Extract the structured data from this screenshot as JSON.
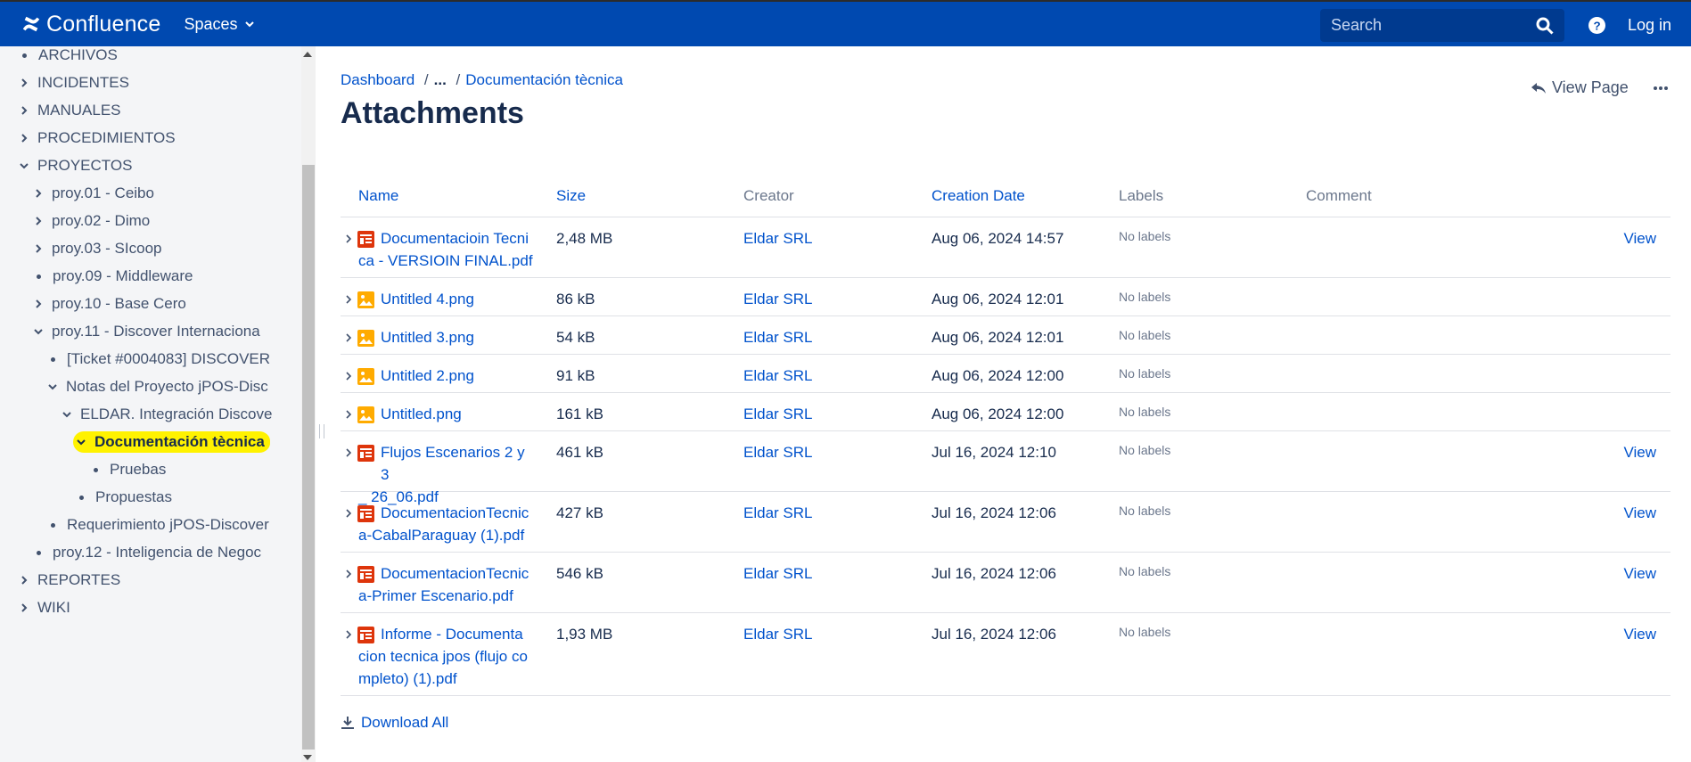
{
  "app": {
    "name": "Confluence",
    "spaces_label": "Spaces",
    "search_placeholder": "Search",
    "login_label": "Log in",
    "brand_color": "#0049b0"
  },
  "sidebar": {
    "items": [
      {
        "label": "ARCHIVOS",
        "toggle": "bullet",
        "level": 0
      },
      {
        "label": "INCIDENTES",
        "toggle": "collapsed",
        "level": 0
      },
      {
        "label": "MANUALES",
        "toggle": "collapsed",
        "level": 0
      },
      {
        "label": "PROCEDIMIENTOS",
        "toggle": "collapsed",
        "level": 0
      },
      {
        "label": "PROYECTOS",
        "toggle": "expanded",
        "level": 0
      },
      {
        "label": "proy.01 - Ceibo",
        "toggle": "collapsed",
        "level": 1
      },
      {
        "label": "proy.02 - Dimo",
        "toggle": "collapsed",
        "level": 1
      },
      {
        "label": "proy.03 - SIcoop",
        "toggle": "collapsed",
        "level": 1
      },
      {
        "label": "proy.09 - Middleware",
        "toggle": "bullet",
        "level": 1
      },
      {
        "label": "proy.10 - Base Cero",
        "toggle": "collapsed",
        "level": 1
      },
      {
        "label": "proy.11 - Discover Internaciona",
        "toggle": "expanded",
        "level": 1
      },
      {
        "label": "[Ticket #0004083] DISCOVER",
        "toggle": "bullet",
        "level": 2
      },
      {
        "label": "Notas del Proyecto jPOS-Disc",
        "toggle": "expanded",
        "level": 2
      },
      {
        "label": "ELDAR. Integración Discove",
        "toggle": "expanded",
        "level": 3
      },
      {
        "label": "Documentación tècnica",
        "toggle": "expanded",
        "level": 4,
        "selected": true
      },
      {
        "label": "Pruebas",
        "toggle": "bullet",
        "level": 5
      },
      {
        "label": "Propuestas",
        "toggle": "bullet",
        "level": 4
      },
      {
        "label": "Requerimiento jPOS-Discover",
        "toggle": "bullet",
        "level": 2
      },
      {
        "label": "proy.12 - Inteligencia de Negoc",
        "toggle": "bullet",
        "level": 1
      },
      {
        "label": "REPORTES",
        "toggle": "collapsed",
        "level": 0
      },
      {
        "label": "WIKI",
        "toggle": "collapsed",
        "level": 0
      }
    ]
  },
  "breadcrumb": {
    "dashboard": "Dashboard",
    "separator": "/",
    "ellipsis": "...",
    "parent": "Documentación tècnica"
  },
  "page": {
    "title": "Attachments",
    "view_page_label": "View Page",
    "download_all_label": "Download All"
  },
  "table": {
    "headers": {
      "name": "Name",
      "size": "Size",
      "creator": "Creator",
      "creation_date": "Creation Date",
      "labels": "Labels",
      "comment": "Comment"
    },
    "rows": [
      {
        "name_lines": [
          "Documentacioin Tecni",
          "ca - VERSIOIN FINAL.pdf"
        ],
        "type": "pdf",
        "size": "2,48 MB",
        "creator": "Eldar SRL",
        "date": "Aug 06, 2024 14:57",
        "labels": "No labels",
        "view": "View"
      },
      {
        "name_lines": [
          "Untitled 4.png"
        ],
        "type": "image",
        "size": "86 kB",
        "creator": "Eldar SRL",
        "date": "Aug 06, 2024 12:01",
        "labels": "No labels",
        "view": ""
      },
      {
        "name_lines": [
          "Untitled 3.png"
        ],
        "type": "image",
        "size": "54 kB",
        "creator": "Eldar SRL",
        "date": "Aug 06, 2024 12:01",
        "labels": "No labels",
        "view": ""
      },
      {
        "name_lines": [
          "Untitled 2.png"
        ],
        "type": "image",
        "size": "91 kB",
        "creator": "Eldar SRL",
        "date": "Aug 06, 2024 12:00",
        "labels": "No labels",
        "view": ""
      },
      {
        "name_lines": [
          "Untitled.png"
        ],
        "type": "image",
        "size": "161 kB",
        "creator": "Eldar SRL",
        "date": "Aug 06, 2024 12:00",
        "labels": "No labels",
        "view": ""
      },
      {
        "name_lines": [
          "Flujos Escenarios 2 y 3",
          "_ 26_06.pdf"
        ],
        "type": "pdf",
        "size": "461 kB",
        "creator": "Eldar SRL",
        "date": "Jul 16, 2024 12:10",
        "labels": "No labels",
        "view": "View"
      },
      {
        "name_lines": [
          "DocumentacionTecnic",
          "a-CabalParaguay (1).pdf"
        ],
        "type": "pdf",
        "size": "427 kB",
        "creator": "Eldar SRL",
        "date": "Jul 16, 2024 12:06",
        "labels": "No labels",
        "view": "View"
      },
      {
        "name_lines": [
          "DocumentacionTecnic",
          "a-Primer Escenario.pdf"
        ],
        "type": "pdf",
        "size": "546 kB",
        "creator": "Eldar SRL",
        "date": "Jul 16, 2024 12:06",
        "labels": "No labels",
        "view": "View"
      },
      {
        "name_lines": [
          "Informe - Documenta",
          "cion tecnica jpos (flujo co",
          "mpleto) (1).pdf"
        ],
        "type": "pdf",
        "size": "1,93 MB",
        "creator": "Eldar SRL",
        "date": "Jul 16, 2024 12:06",
        "labels": "No labels",
        "view": "View"
      }
    ]
  }
}
